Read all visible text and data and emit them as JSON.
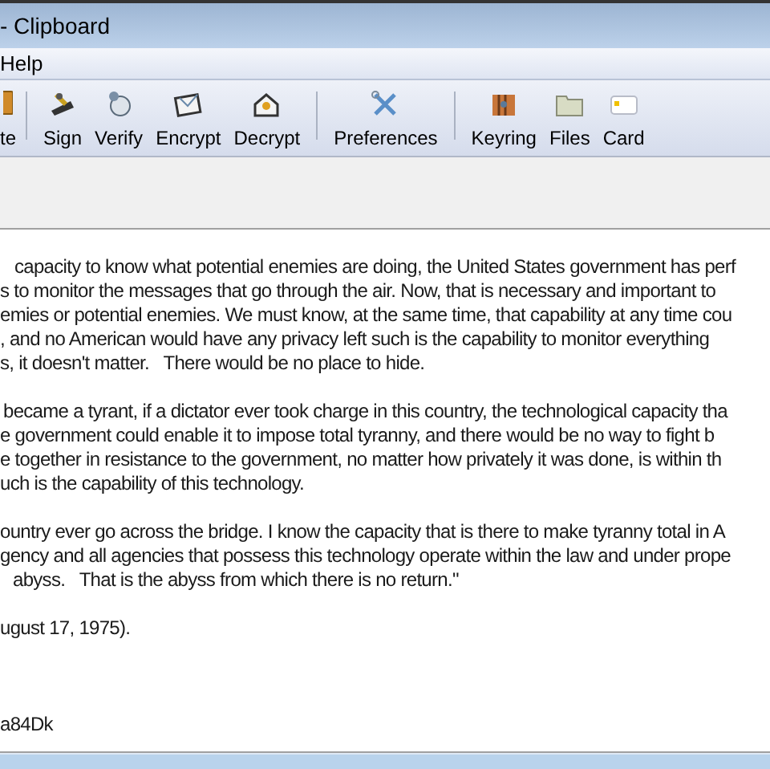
{
  "window": {
    "title": "- Clipboard"
  },
  "menu": [
    "Help"
  ],
  "toolbar": [
    {
      "kind": "button",
      "label": "te"
    },
    {
      "kind": "separator"
    },
    {
      "kind": "button",
      "label": "Sign"
    },
    {
      "kind": "button",
      "label": "Verify"
    },
    {
      "kind": "button",
      "label": "Encrypt"
    },
    {
      "kind": "button",
      "label": "Decrypt"
    },
    {
      "kind": "separator"
    },
    {
      "kind": "button",
      "label": "Preferences"
    },
    {
      "kind": "separator"
    },
    {
      "kind": "button",
      "label": "Keyring"
    },
    {
      "kind": "button",
      "label": "Files"
    },
    {
      "kind": "button",
      "label": "Card"
    }
  ],
  "editor": {
    "paragraphs": [
      [
        "capacity to know what potential enemies are doing, the United States government has perf",
        "s to monitor the messages that go through the air. Now, that is necessary and important to",
        "emies or potential enemies. We must know, at the same time, that capability at any time cou",
        ", and no American would have any privacy left such is the capability to monitor everything",
        "s, it doesn't matter.   There would be no place to hide."
      ],
      [
        "became a tyrant, if a dictator ever took charge in this country, the technological capacity tha",
        "e government could enable it to impose total tyranny, and there would be no way to fight b",
        "e together in resistance to the government, no matter how privately it was done, is within th",
        "uch is the capability of this technology."
      ],
      [
        "ountry ever go across the bridge. I know the capacity that is there to make tyranny total in A",
        "gency and all agencies that possess this technology operate within the law and under prope",
        "abyss.   That is the abyss from which there is no return.\""
      ],
      [
        "ugust 17, 1975)."
      ],
      [
        "a84Dk"
      ]
    ]
  }
}
